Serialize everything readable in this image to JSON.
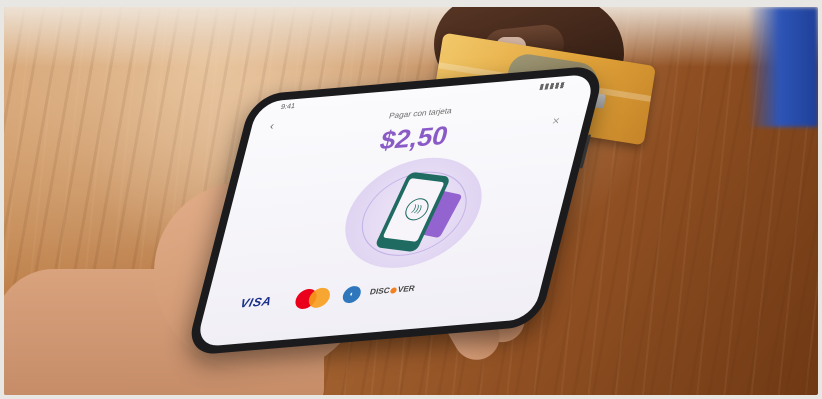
{
  "payment_screen": {
    "time": "9:41",
    "title": "Pagar con tarjeta",
    "amount": "$2,50",
    "close_glyph": "×",
    "back_glyph": "‹"
  },
  "card_brands": {
    "visa": "VISA",
    "discover_left": "DISC",
    "discover_right": "VER"
  },
  "colors": {
    "amount_purple": "#8a5bc7",
    "phone_illustration_green": "#1f6b62",
    "card_purple": "#9363cf",
    "wood": "#b06e39"
  }
}
